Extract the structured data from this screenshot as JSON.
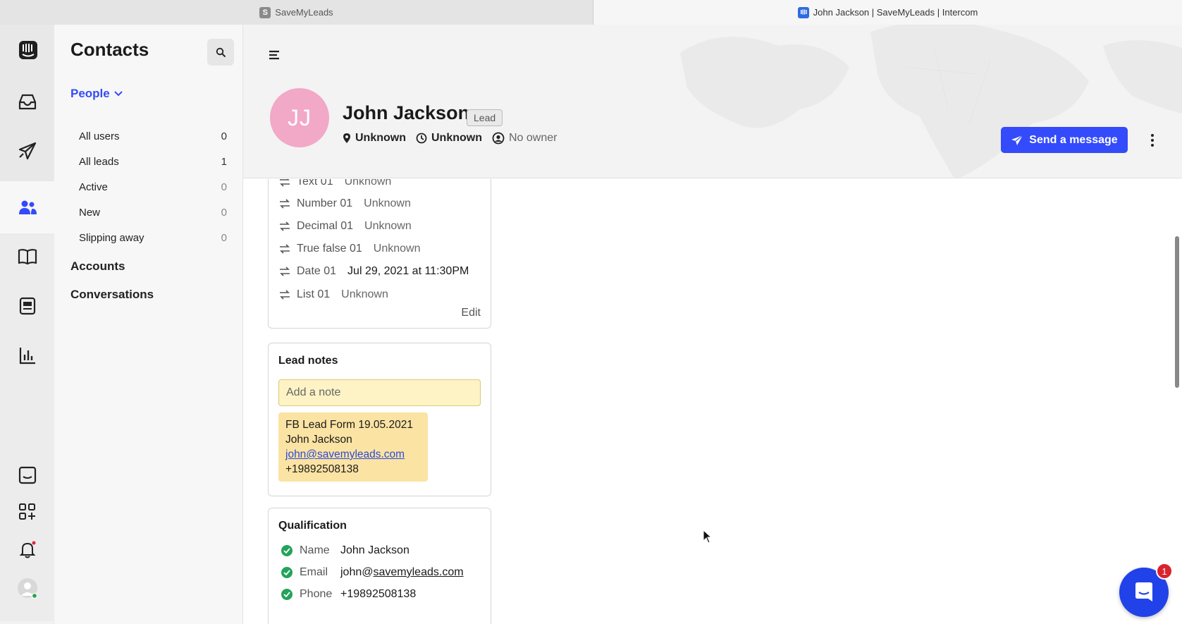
{
  "browser": {
    "tabs": [
      {
        "label": "SaveMyLeads",
        "favicon": "S"
      },
      {
        "label": "John Jackson | SaveMyLeads | Intercom"
      }
    ]
  },
  "rail": {
    "icons": [
      "intercom-logo-icon",
      "inbox-icon",
      "outbound-icon",
      "contacts-icon",
      "articles-icon",
      "messages-icon",
      "reports-icon",
      "messenger-icon",
      "apps-icon",
      "bell-icon",
      "user-avatar-icon"
    ]
  },
  "sidebar": {
    "title": "Contacts",
    "people_label": "People",
    "items": [
      {
        "label": "All users",
        "count": "0"
      },
      {
        "label": "All leads",
        "count": "1"
      },
      {
        "label": "Active",
        "count": "0"
      },
      {
        "label": "New",
        "count": "0"
      },
      {
        "label": "Slipping away",
        "count": "0"
      }
    ],
    "accounts": "Accounts",
    "conversations": "Conversations"
  },
  "profile": {
    "initials": "JJ",
    "name": "John Jackson",
    "badge": "Lead",
    "location": "Unknown",
    "local_time": "Unknown",
    "owner": "No owner",
    "send_button": "Send a message"
  },
  "attributes": {
    "rows": [
      {
        "key": "Text 01",
        "value": "Unknown"
      },
      {
        "key": "Number 01",
        "value": "Unknown"
      },
      {
        "key": "Decimal 01",
        "value": "Unknown"
      },
      {
        "key": "True false 01",
        "value": "Unknown"
      },
      {
        "key": "Date 01",
        "value": "Jul 29, 2021 at 11:30PM"
      },
      {
        "key": "List 01",
        "value": "Unknown"
      }
    ],
    "edit_label": "Edit"
  },
  "lead_notes": {
    "title": "Lead notes",
    "placeholder": "Add a note",
    "note": {
      "line1": "FB Lead Form 19.05.2021",
      "line2": "John Jackson",
      "email": "john@savemyleads.com",
      "phone": "+19892508138"
    }
  },
  "qualification": {
    "title": "Qualification",
    "rows": [
      {
        "key": "Name",
        "value": "John Jackson"
      },
      {
        "key": "Email",
        "value_prefix": "john@",
        "value_link": "savemyleads.com"
      },
      {
        "key": "Phone",
        "value": "+19892508138"
      }
    ]
  },
  "messenger": {
    "badge": "1"
  },
  "colors": {
    "accent": "#334bfa",
    "avatar": "#f2a8c7",
    "note_bg": "#fbe3a3",
    "check": "#24a35a",
    "badge": "#d9232e"
  }
}
